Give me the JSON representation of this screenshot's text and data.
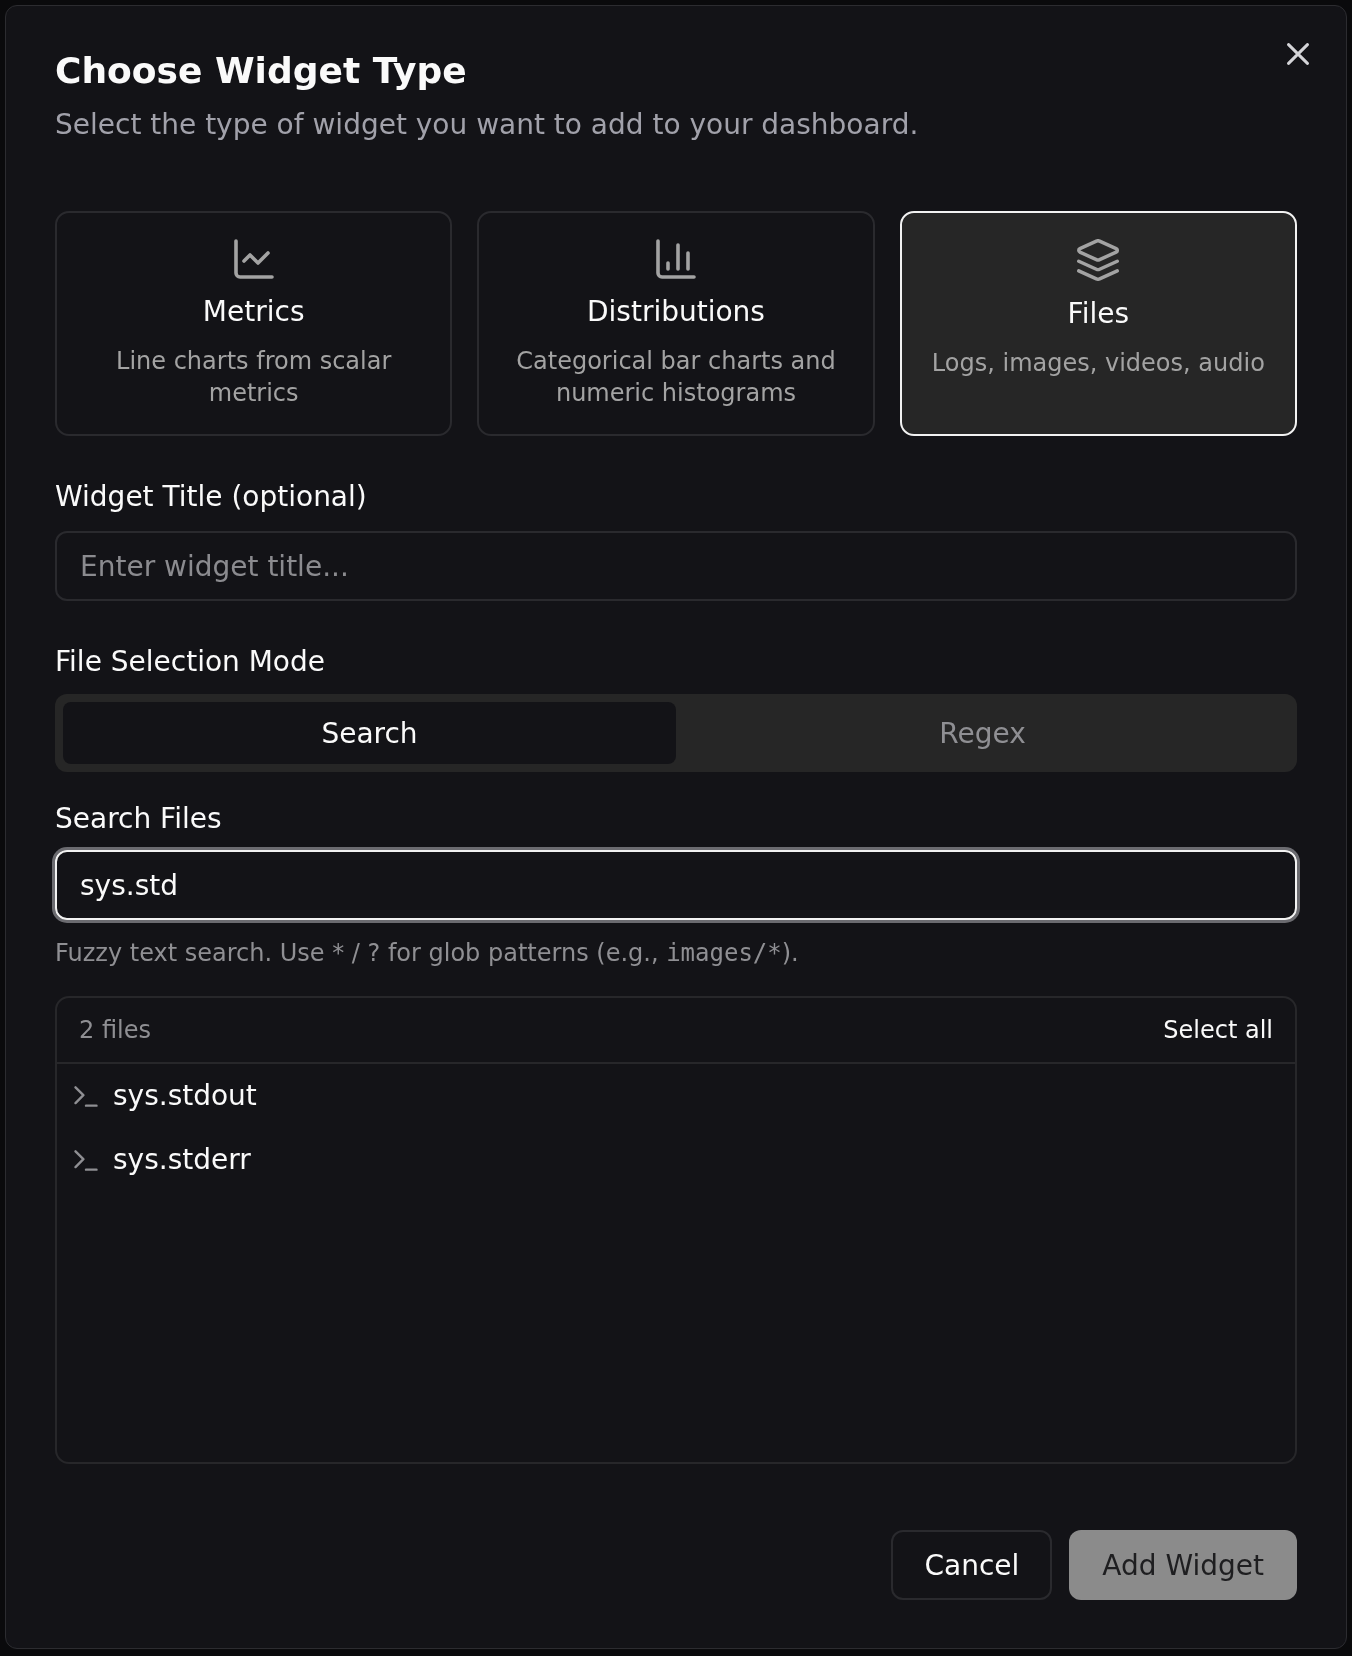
{
  "dialog": {
    "title": "Choose Widget Type",
    "subtitle": "Select the type of widget you want to add to your dashboard."
  },
  "widget_types": [
    {
      "label": "Metrics",
      "description": "Line charts from scalar metrics",
      "selected": false
    },
    {
      "label": "Distributions",
      "description": "Categorical bar charts and numeric histograms",
      "selected": false
    },
    {
      "label": "Files",
      "description": "Logs, images, videos, audio",
      "selected": true
    }
  ],
  "widget_title": {
    "label": "Widget Title (optional)",
    "placeholder": "Enter widget title...",
    "focused": false
  },
  "file_selection_mode": {
    "label": "File Selection Mode",
    "options": [
      {
        "label": "Search",
        "selected": true
      },
      {
        "label": "Regex",
        "selected": false
      }
    ]
  },
  "search_files": {
    "label": "Search Files",
    "value": "sys.std",
    "focused": true,
    "help": [
      {
        "kind": "text",
        "text": "Fuzzy text search. Use * / ? for glob patterns (e.g., "
      },
      {
        "kind": "code",
        "text": "images/*"
      },
      {
        "kind": "text",
        "text": ")."
      }
    ]
  },
  "file_list": {
    "count": "2 files",
    "select_all": "Select all",
    "files": [
      {
        "name": "sys.stdout"
      },
      {
        "name": "sys.stderr"
      }
    ]
  },
  "footer": {
    "buttons": [
      {
        "label": "Cancel",
        "kind": "secondary",
        "disabled": false
      },
      {
        "label": "Add Widget",
        "kind": "primary",
        "disabled": true
      }
    ]
  }
}
